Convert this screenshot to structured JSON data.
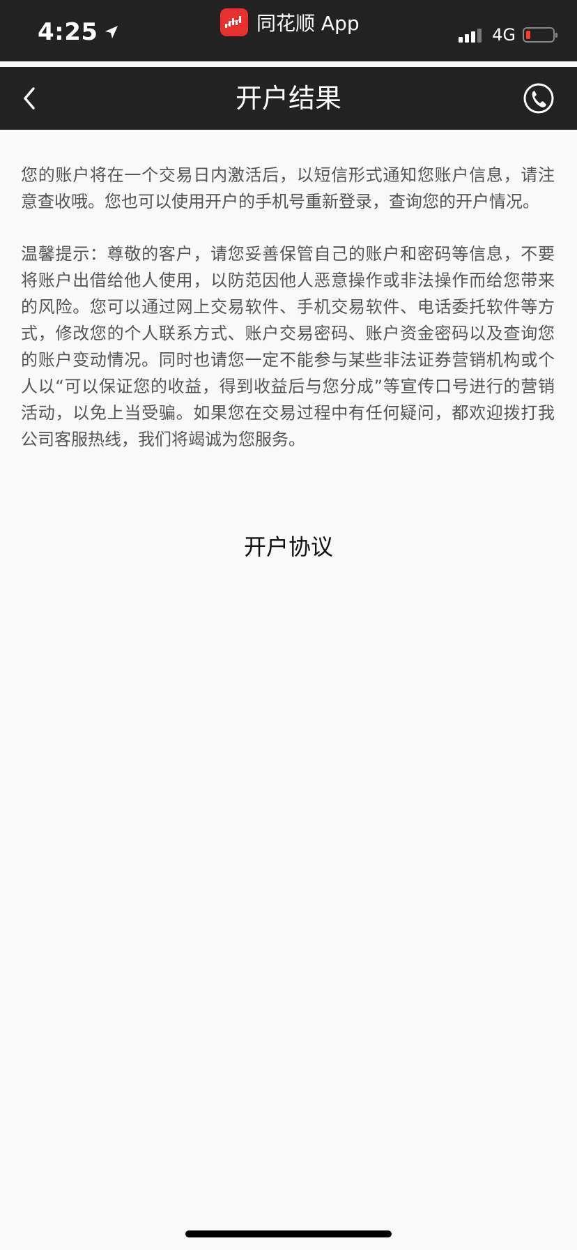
{
  "status_bar": {
    "time": "4:25",
    "app_name": "同花顺 App",
    "network": "4G",
    "signal_bars": 3,
    "battery_level": 0.15,
    "battery_color": "#ff3b30"
  },
  "nav": {
    "title": "开户结果"
  },
  "content": {
    "paragraph1": "您的账户将在一个交易日内激活后，以短信形式通知您账户信息，请注意查收哦。您也可以使用开户的手机号重新登录，查询您的开户情况。",
    "paragraph2": "温馨提示：尊敬的客户，请您妥善保管自己的账户和密码等信息，不要将账户出借给他人使用，以防范因他人恶意操作或非法操作而给您带来的风险。您可以通过网上交易软件、手机交易软件、电话委托软件等方式，修改您的个人联系方式、账户交易密码、账户资金密码以及查询您的账户变动情况。同时也请您一定不能参与某些非法证券营销机构或个人以“可以保证您的收益，得到收益后与您分成”等宣传口号进行的营销活动，以免上当受骗。如果您在交易过程中有任何疑问，都欢迎拨打我公司客服热线，我们将竭诚为您服务。",
    "agreement_link": "开户协议"
  },
  "icons": {
    "back": "chevron-left-icon",
    "phone": "phone-icon",
    "location": "location-arrow-icon",
    "logo": "app-logo-icon"
  },
  "colors": {
    "bar_background": "#222222",
    "page_background": "#f9f9f9",
    "body_text": "#555555",
    "brand_red": "#e8302e"
  }
}
